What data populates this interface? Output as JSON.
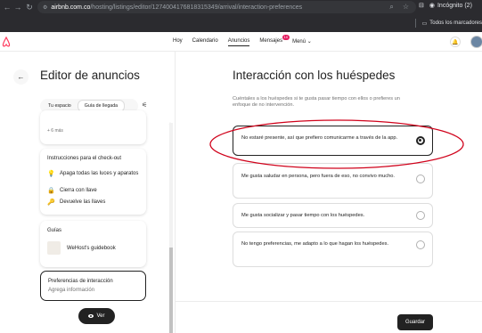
{
  "browser": {
    "url_host": "airbnb.com.co",
    "url_path": "/hosting/listings/editor/1274004176818315349/arrival/interaction-preferences",
    "incognito_label": "Incógnito (2)",
    "bookmarks_label": "Todos los marcadores"
  },
  "header": {
    "nav": [
      "Hoy",
      "Calendario",
      "Anuncios",
      "Mensajes",
      "Menú"
    ],
    "active_index": 2,
    "messages_badge": "10",
    "brand_color": "#ff385c"
  },
  "editor": {
    "title": "Editor de anuncios",
    "tabs": [
      "Tu espacio",
      "Guía de llegada"
    ],
    "active_tab": 1,
    "more_label": "+ 6 más",
    "checkout": {
      "title": "Instrucciones para el check-out",
      "items": [
        {
          "icon": "lightbulb-icon",
          "label": "Apaga todas las luces y aparatos"
        },
        {
          "icon": "lock-icon",
          "label": "Cierra con llave"
        },
        {
          "icon": "key-icon",
          "label": "Devuelve las llaves"
        }
      ]
    },
    "guides": {
      "title": "Guías",
      "guide_name": "WeHost's guidebook"
    },
    "interaction": {
      "title": "Preferencias de interacción",
      "subtitle": "Agrega información"
    },
    "view_button": "Ver"
  },
  "main": {
    "title": "Interacción con los huéspedes",
    "description": "Cuéntales a los huéspedes si te gusta pasar tiempo con ellos o prefieres un enfoque de no intervención.",
    "options": [
      {
        "label": "No estaré presente, así que prefiero comunicarme a través de la app.",
        "selected": true
      },
      {
        "label": "Me gusta saludar en persona, pero fuera de eso, no convivo mucho.",
        "selected": false
      },
      {
        "label": "Me gusta socializar y pasar tiempo con los huéspedes.",
        "selected": false
      },
      {
        "label": "No tengo preferencias, me adapto a lo que hagan los huéspedes.",
        "selected": false
      }
    ],
    "annotation_color": "#d0021b",
    "save_button": "Guardar"
  }
}
